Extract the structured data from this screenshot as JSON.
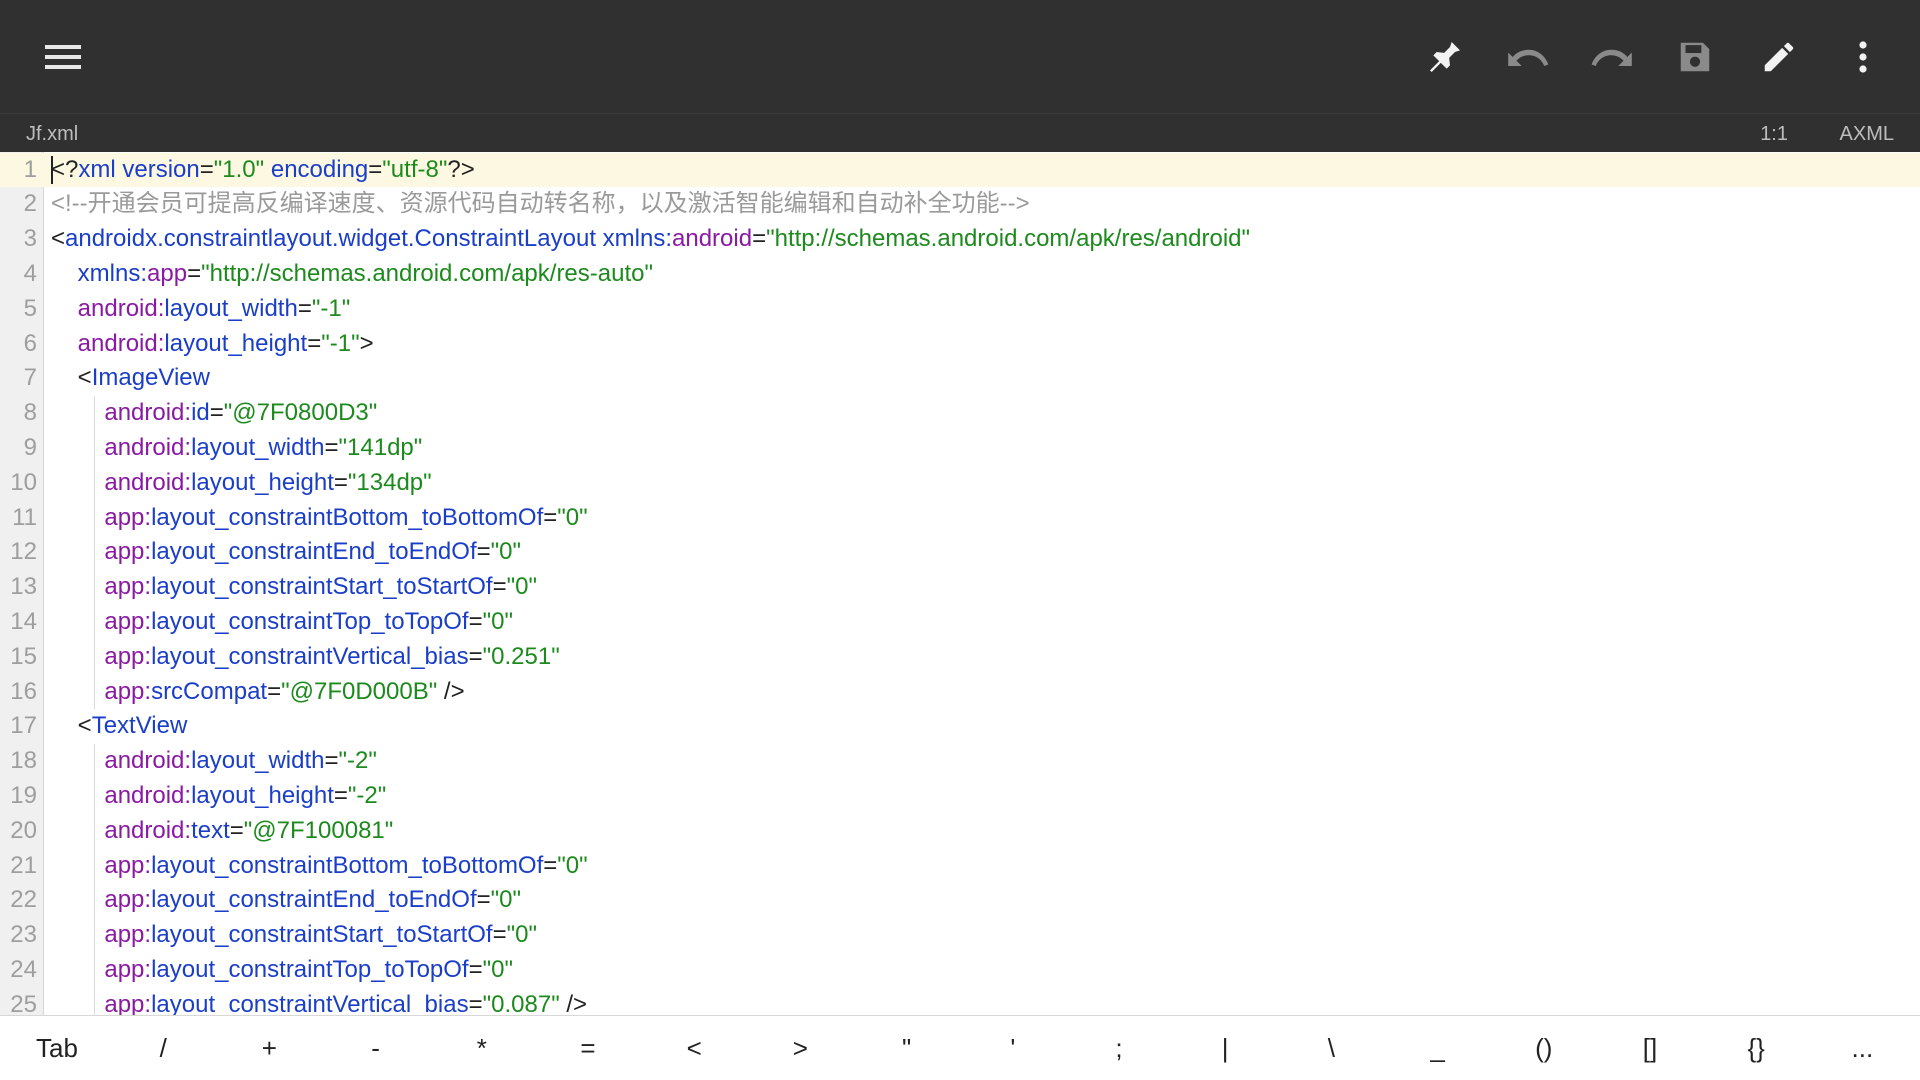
{
  "toolbar": {
    "icons": [
      "menu-icon",
      "pin-icon",
      "undo-icon",
      "redo-icon",
      "save-icon",
      "edit-icon",
      "more-icon"
    ]
  },
  "status": {
    "filename": "Jf.xml",
    "position": "1:1",
    "language": "AXML"
  },
  "editor": {
    "line_numbers": [
      "1",
      "2",
      "3",
      "4",
      "5",
      "6",
      "7",
      "8",
      "9",
      "10",
      "11",
      "12",
      "13",
      "14",
      "15",
      "16",
      "17",
      "18",
      "19",
      "20",
      "21",
      "22",
      "23",
      "24",
      "25"
    ],
    "lines": [
      [
        {
          "t": "<?",
          "c": "punct"
        },
        {
          "t": "xml",
          "c": "tag"
        },
        {
          "t": " ",
          "c": "punct"
        },
        {
          "t": "version",
          "c": "attr"
        },
        {
          "t": "=",
          "c": "punct"
        },
        {
          "t": "\"1.0\"",
          "c": "val"
        },
        {
          "t": " ",
          "c": "punct"
        },
        {
          "t": "encoding",
          "c": "attr"
        },
        {
          "t": "=",
          "c": "punct"
        },
        {
          "t": "\"utf-8\"",
          "c": "val"
        },
        {
          "t": "?>",
          "c": "punct"
        }
      ],
      [
        {
          "t": "<!--开通会员可提高反编译速度、资源代码自动转名称，以及激活智能编辑和自动补全功能-->",
          "c": "comment"
        }
      ],
      [
        {
          "t": "<",
          "c": "punct"
        },
        {
          "t": "androidx.constraintlayout.widget.ConstraintLayout",
          "c": "tag"
        },
        {
          "t": " ",
          "c": "punct"
        },
        {
          "t": "xmlns:",
          "c": "attr"
        },
        {
          "t": "android",
          "c": "ns"
        },
        {
          "t": "=",
          "c": "punct"
        },
        {
          "t": "\"http://schemas.android.com/apk/res/android\"",
          "c": "val"
        }
      ],
      [
        {
          "t": "    ",
          "c": "punct"
        },
        {
          "t": "xmlns:",
          "c": "attr"
        },
        {
          "t": "app",
          "c": "ns"
        },
        {
          "t": "=",
          "c": "punct"
        },
        {
          "t": "\"http://schemas.android.com/apk/res-auto\"",
          "c": "val"
        }
      ],
      [
        {
          "t": "    ",
          "c": "punct"
        },
        {
          "t": "android:",
          "c": "ns"
        },
        {
          "t": "layout_width",
          "c": "attr"
        },
        {
          "t": "=",
          "c": "punct"
        },
        {
          "t": "\"-1\"",
          "c": "val"
        }
      ],
      [
        {
          "t": "    ",
          "c": "punct"
        },
        {
          "t": "android:",
          "c": "ns"
        },
        {
          "t": "layout_height",
          "c": "attr"
        },
        {
          "t": "=",
          "c": "punct"
        },
        {
          "t": "\"-1\"",
          "c": "val"
        },
        {
          "t": ">",
          "c": "punct"
        }
      ],
      [
        {
          "t": "    <",
          "c": "punct"
        },
        {
          "t": "ImageView",
          "c": "tag"
        }
      ],
      [
        {
          "t": "        ",
          "c": "punct"
        },
        {
          "t": "android:",
          "c": "ns"
        },
        {
          "t": "id",
          "c": "attr"
        },
        {
          "t": "=",
          "c": "punct"
        },
        {
          "t": "\"@7F0800D3\"",
          "c": "val"
        }
      ],
      [
        {
          "t": "        ",
          "c": "punct"
        },
        {
          "t": "android:",
          "c": "ns"
        },
        {
          "t": "layout_width",
          "c": "attr"
        },
        {
          "t": "=",
          "c": "punct"
        },
        {
          "t": "\"141dp\"",
          "c": "val"
        }
      ],
      [
        {
          "t": "        ",
          "c": "punct"
        },
        {
          "t": "android:",
          "c": "ns"
        },
        {
          "t": "layout_height",
          "c": "attr"
        },
        {
          "t": "=",
          "c": "punct"
        },
        {
          "t": "\"134dp\"",
          "c": "val"
        }
      ],
      [
        {
          "t": "        ",
          "c": "punct"
        },
        {
          "t": "app:",
          "c": "ns"
        },
        {
          "t": "layout_constraintBottom_toBottomOf",
          "c": "attr"
        },
        {
          "t": "=",
          "c": "punct"
        },
        {
          "t": "\"0\"",
          "c": "val"
        }
      ],
      [
        {
          "t": "        ",
          "c": "punct"
        },
        {
          "t": "app:",
          "c": "ns"
        },
        {
          "t": "layout_constraintEnd_toEndOf",
          "c": "attr"
        },
        {
          "t": "=",
          "c": "punct"
        },
        {
          "t": "\"0\"",
          "c": "val"
        }
      ],
      [
        {
          "t": "        ",
          "c": "punct"
        },
        {
          "t": "app:",
          "c": "ns"
        },
        {
          "t": "layout_constraintStart_toStartOf",
          "c": "attr"
        },
        {
          "t": "=",
          "c": "punct"
        },
        {
          "t": "\"0\"",
          "c": "val"
        }
      ],
      [
        {
          "t": "        ",
          "c": "punct"
        },
        {
          "t": "app:",
          "c": "ns"
        },
        {
          "t": "layout_constraintTop_toTopOf",
          "c": "attr"
        },
        {
          "t": "=",
          "c": "punct"
        },
        {
          "t": "\"0\"",
          "c": "val"
        }
      ],
      [
        {
          "t": "        ",
          "c": "punct"
        },
        {
          "t": "app:",
          "c": "ns"
        },
        {
          "t": "layout_constraintVertical_bias",
          "c": "attr"
        },
        {
          "t": "=",
          "c": "punct"
        },
        {
          "t": "\"0.251\"",
          "c": "val"
        }
      ],
      [
        {
          "t": "        ",
          "c": "punct"
        },
        {
          "t": "app:",
          "c": "ns"
        },
        {
          "t": "srcCompat",
          "c": "attr"
        },
        {
          "t": "=",
          "c": "punct"
        },
        {
          "t": "\"@7F0D000B\"",
          "c": "val"
        },
        {
          "t": " />",
          "c": "punct"
        }
      ],
      [
        {
          "t": "    <",
          "c": "punct"
        },
        {
          "t": "TextView",
          "c": "tag"
        }
      ],
      [
        {
          "t": "        ",
          "c": "punct"
        },
        {
          "t": "android:",
          "c": "ns"
        },
        {
          "t": "layout_width",
          "c": "attr"
        },
        {
          "t": "=",
          "c": "punct"
        },
        {
          "t": "\"-2\"",
          "c": "val"
        }
      ],
      [
        {
          "t": "        ",
          "c": "punct"
        },
        {
          "t": "android:",
          "c": "ns"
        },
        {
          "t": "layout_height",
          "c": "attr"
        },
        {
          "t": "=",
          "c": "punct"
        },
        {
          "t": "\"-2\"",
          "c": "val"
        }
      ],
      [
        {
          "t": "        ",
          "c": "punct"
        },
        {
          "t": "android:",
          "c": "ns"
        },
        {
          "t": "text",
          "c": "attr"
        },
        {
          "t": "=",
          "c": "punct"
        },
        {
          "t": "\"@7F100081\"",
          "c": "val"
        }
      ],
      [
        {
          "t": "        ",
          "c": "punct"
        },
        {
          "t": "app:",
          "c": "ns"
        },
        {
          "t": "layout_constraintBottom_toBottomOf",
          "c": "attr"
        },
        {
          "t": "=",
          "c": "punct"
        },
        {
          "t": "\"0\"",
          "c": "val"
        }
      ],
      [
        {
          "t": "        ",
          "c": "punct"
        },
        {
          "t": "app:",
          "c": "ns"
        },
        {
          "t": "layout_constraintEnd_toEndOf",
          "c": "attr"
        },
        {
          "t": "=",
          "c": "punct"
        },
        {
          "t": "\"0\"",
          "c": "val"
        }
      ],
      [
        {
          "t": "        ",
          "c": "punct"
        },
        {
          "t": "app:",
          "c": "ns"
        },
        {
          "t": "layout_constraintStart_toStartOf",
          "c": "attr"
        },
        {
          "t": "=",
          "c": "punct"
        },
        {
          "t": "\"0\"",
          "c": "val"
        }
      ],
      [
        {
          "t": "        ",
          "c": "punct"
        },
        {
          "t": "app:",
          "c": "ns"
        },
        {
          "t": "layout_constraintTop_toTopOf",
          "c": "attr"
        },
        {
          "t": "=",
          "c": "punct"
        },
        {
          "t": "\"0\"",
          "c": "val"
        }
      ],
      [
        {
          "t": "        ",
          "c": "punct"
        },
        {
          "t": "app:",
          "c": "ns"
        },
        {
          "t": "layout_constraintVertical_bias",
          "c": "attr"
        },
        {
          "t": "=",
          "c": "punct"
        },
        {
          "t": "\"0.087\"",
          "c": "val"
        },
        {
          "t": " />",
          "c": "punct"
        }
      ]
    ]
  },
  "symbols": [
    "Tab",
    "/",
    "+",
    "-",
    "*",
    "=",
    "<",
    ">",
    "\"",
    "'",
    ";",
    "|",
    "\\",
    "_",
    "()",
    "[]",
    "{}",
    "..."
  ],
  "colors": {
    "toolbar_bg": "#303030",
    "tag": "#1a3ec7",
    "namespace": "#8a1aa3",
    "value": "#1d8a1d",
    "comment": "#9a9a9a",
    "current_line": "#fdf8e1"
  }
}
